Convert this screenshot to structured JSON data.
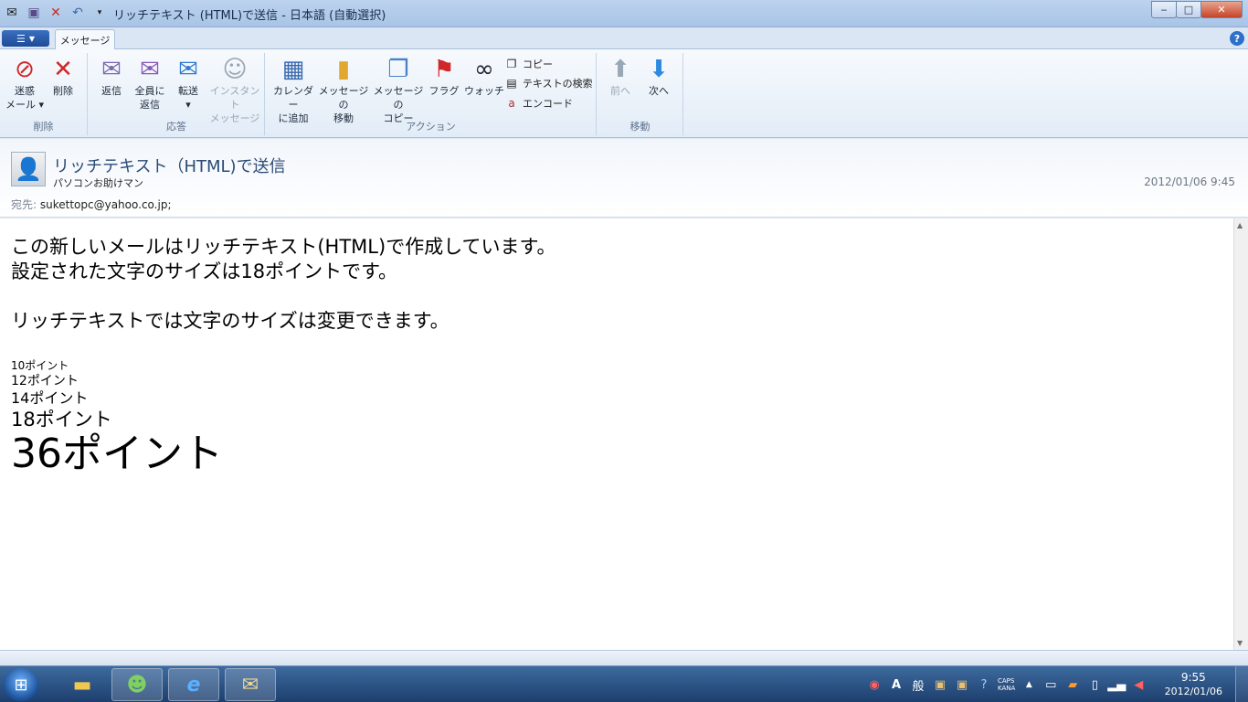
{
  "window": {
    "title": "リッチテキスト (HTML)で送信 - 日本語 (自動選択)",
    "minimize": "‒",
    "maximize": "□",
    "close": "✕"
  },
  "ribbon": {
    "tab": "メッセージ",
    "help": "?",
    "groups": {
      "delete": "削除",
      "respond": "応答",
      "actions": "アクション",
      "move": "移動"
    },
    "buttons": {
      "junk": "迷惑\nメール ▾",
      "delete": "削除",
      "reply": "返信",
      "reply_all": "全員に\n返信",
      "forward": "転送\n▾",
      "instant_message": "インスタント\nメッセージ",
      "add_to_calendar": "カレンダー\nに追加",
      "move_message": "メッセージの\n移動",
      "copy_message": "メッセージの\nコピー",
      "flag": "フラグ",
      "watch": "ウォッチ",
      "prev": "前へ",
      "next": "次へ"
    },
    "small_buttons": {
      "copy": "コピー",
      "find_text": "テキストの検索",
      "encode": "エンコード"
    }
  },
  "message": {
    "subject": "リッチテキスト（HTML)で送信",
    "from": "パソコンお助けマン",
    "date": "2012/01/06 9:45",
    "to_label": "宛先:",
    "to": "sukettopc@yahoo.co.jp;",
    "body": {
      "line1": "この新しいメールはリッチテキスト(HTML)で作成しています。",
      "line2": "設定された文字のサイズは18ポイントです。",
      "line3": "リッチテキストでは文字のサイズは変更できます。",
      "size10": "10ポイント",
      "size12": "12ポイント",
      "size14": "14ポイント",
      "size18": "18ポイント",
      "size36": "36ポイント"
    }
  },
  "taskbar": {
    "ime_mode": "A",
    "ime_kanji": "般",
    "caps": "CAPS",
    "kana": "KANA",
    "time": "9:55",
    "date": "2012/01/06"
  }
}
